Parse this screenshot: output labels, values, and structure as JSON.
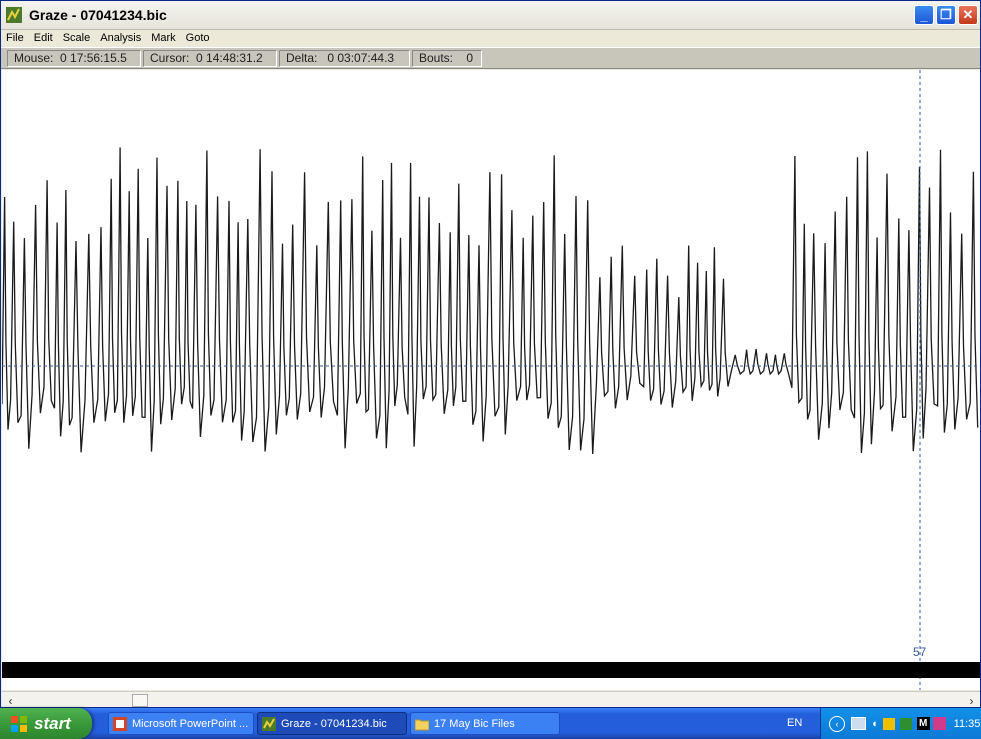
{
  "window": {
    "title": "Graze - 07041234.bic"
  },
  "menu": {
    "items": [
      "File",
      "Edit",
      "Scale",
      "Analysis",
      "Mark",
      "Goto"
    ]
  },
  "status": {
    "mouse": "Mouse:  0 17:56:15.5",
    "cursor": "Cursor:  0 14:48:31.2",
    "delta": "Delta:   0 03:07:44.3",
    "bouts": "Bouts:    0"
  },
  "plot": {
    "cursor_label": "57"
  },
  "taskbar": {
    "start": "start",
    "tasks": [
      "Microsoft PowerPoint ...",
      "Graze - 07041234.bic",
      "17 May Bic Files"
    ],
    "language": "EN",
    "clock": "11:35"
  },
  "icons": [
    "graze-app-icon",
    "minimize-icon",
    "restore-icon",
    "close-icon",
    "scroll-left-icon",
    "scroll-right-icon",
    "windows-logo-icon",
    "powerpoint-icon",
    "folder-icon",
    "tray-back-icon",
    "network-icon",
    "volume-icon",
    "antivirus-icon"
  ]
}
